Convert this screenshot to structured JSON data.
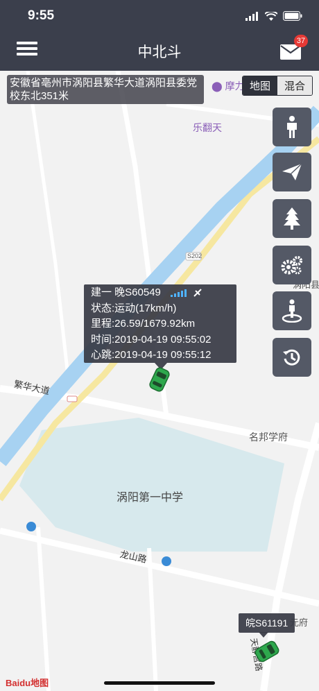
{
  "status_bar": {
    "time": "9:55"
  },
  "nav": {
    "title": "中北斗",
    "mail_badge": "37"
  },
  "address": "安徽省亳州市涡阳县繁华大道涡阳县委党校东北351米",
  "map_type": {
    "map": "地图",
    "hybrid": "混合",
    "selected": "map"
  },
  "side_buttons": [
    "person-icon",
    "send-icon",
    "tree-icon",
    "gears-icon",
    "location-person-icon",
    "history-icon"
  ],
  "vehicle_info": {
    "plate": "建一 晚S60549",
    "status": "状态:运动(17km/h)",
    "mileage": "里程:26.59/1679.92km",
    "time": "时间:2019-04-19 09:55:02",
    "heartbeat": "心跳:2019-04-19 09:55:12"
  },
  "vehicle2": {
    "plate": "皖S61191"
  },
  "map_labels": {
    "poi_moliketop": "摩力克",
    "poi_fanyitian": "乐翻天",
    "poi_mingbang": "名邦学府",
    "school": "涡阳第一中学",
    "road_fanhua": "繁华大道",
    "road_longshan": "龙山路",
    "road_tianjing": "天静宫路",
    "shield_s202": "S202",
    "poi_guoyang": "涡阳县",
    "poi_fu": "元府"
  },
  "logo": "Baidu地图",
  "colors": {
    "bar": "#3b3f4c",
    "water": "#a7d2f2",
    "school": "#d7e9ed",
    "road_yellow": "#f6e7a0",
    "poi_purple": "#8b5fb8",
    "car_green": "#2ea84d"
  }
}
